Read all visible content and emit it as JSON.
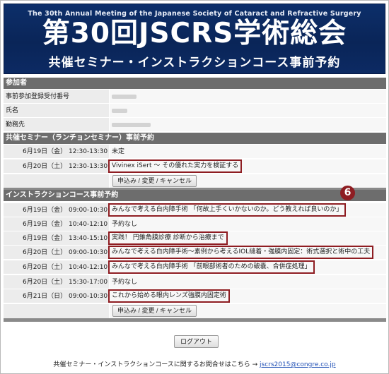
{
  "banner": {
    "subtitle_en": "The 30th Annual Meeting of the Japanese Society of Cataract and Refractive Surgery",
    "main_title": "第30回JSCRS学術総会",
    "sub_title_jp": "共催セミナー・インストラクションコース事前予約"
  },
  "participant": {
    "header": "参加者",
    "rows": [
      {
        "label": "事前参加登録受付番号"
      },
      {
        "label": "氏名"
      },
      {
        "label": "勤務先"
      }
    ]
  },
  "seminar": {
    "header": "共催セミナー（ランチョンセミナー）事前予約",
    "rows": [
      {
        "time": "6月19日（金） 12:30-13:30",
        "value": "未定"
      },
      {
        "time": "6月20日（土） 12:30-13:30",
        "value": "Vivinex iSert ～ その優れた実力を検証する"
      }
    ],
    "button": "申込み / 変更 / キャンセル"
  },
  "course": {
    "header": "インストラクションコース事前予約",
    "badge": "6",
    "rows": [
      {
        "time": "6月19日（金） 09:00-10:30",
        "value": "みんなで考える白内障手術 「何故上手くいかないのか。どう教えれば良いのか」"
      },
      {
        "time": "6月19日（金） 10:40-12:10",
        "value": "予約なし"
      },
      {
        "time": "6月19日（金） 13:40-15:10",
        "value": "実践！ 円錐角膜診療 診断から治療まで"
      },
      {
        "time": "6月20日（土） 09:00-10:30",
        "value": "みんなで考える白内障手術～素例から考えるIOL縫着・強膜内固定：術式選択と術中の工夫"
      },
      {
        "time": "6月20日（土） 10:40-12:10",
        "value": "みんなで考える白内障手術 「前眼部術者のための破嚢、合併症処理」"
      },
      {
        "time": "6月20日（土） 15:30-17:00",
        "value": "予約なし"
      },
      {
        "time": "6月21日（日） 09:00-10:30",
        "value": "これから始める眼内レンズ強膜内固定術"
      }
    ],
    "button": "申込み / 変更 / キャンセル"
  },
  "logout_label": "ログアウト",
  "footer": {
    "text": "共催セミナー・インストラクションコースに関するお問合せはこちら →",
    "email": "jscrs2015@congre.co.jp"
  }
}
